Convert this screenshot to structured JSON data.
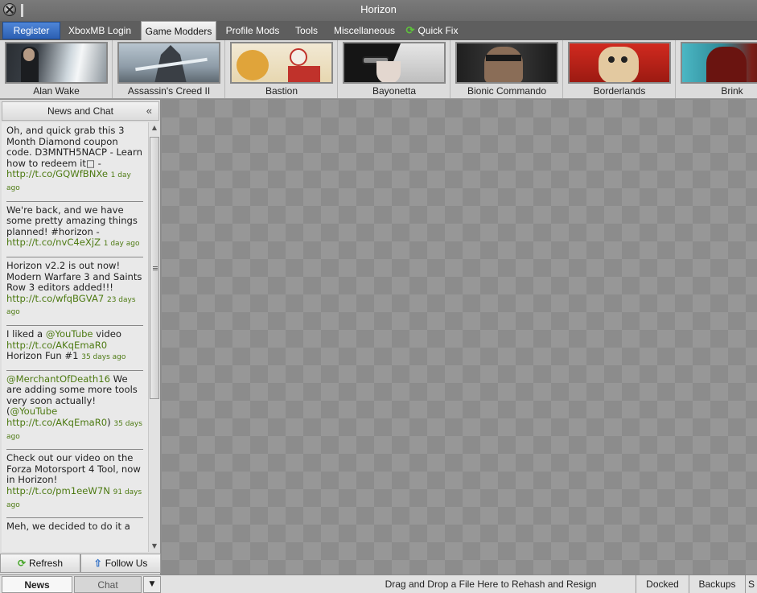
{
  "window": {
    "title": "Horizon"
  },
  "menu": {
    "tabs": [
      {
        "label": "Register"
      },
      {
        "label": "XboxMB Login"
      },
      {
        "label": "Game Modders"
      },
      {
        "label": "Profile Mods"
      },
      {
        "label": "Tools"
      },
      {
        "label": "Miscellaneous"
      },
      {
        "label": "Quick Fix"
      }
    ],
    "active_tab": "Game Modders"
  },
  "games": [
    {
      "name": "Alan Wake"
    },
    {
      "name": "Assassin's Creed II"
    },
    {
      "name": "Bastion"
    },
    {
      "name": "Bayonetta"
    },
    {
      "name": "Bionic Commando"
    },
    {
      "name": "Borderlands"
    },
    {
      "name": "Brink"
    }
  ],
  "news_panel": {
    "header": "News and Chat",
    "collapse_glyph": "«",
    "items": [
      {
        "text": "Oh, and quick grab this 3 Month Diamond coupon code. D3MNTH5NACP - Learn how to redeem it□ - ",
        "link": "http://t.co/GQWfBNXe",
        "time": "1 day ago"
      },
      {
        "text": "We're back, and we have some pretty amazing things planned! #horizon - ",
        "link": "http://t.co/nvC4eXjZ",
        "time": "1 day ago"
      },
      {
        "text": "Horizon v2.2 is out now! Modern Warfare 3 and Saints Row 3 editors added!!! ",
        "link": "http://t.co/wfqBGVA7",
        "time": "23 days ago"
      },
      {
        "pre": "I liked a ",
        "mention": "@YouTube",
        "text": " video ",
        "link": "http://t.co/AKqEmaR0",
        "post": " Horizon Fun #1",
        "time": "35 days ago"
      },
      {
        "mention": "@MerchantOfDeath16",
        "text": " We are adding some more tools very soon actually! (",
        "mention2": "@YouTube",
        "link": "http://t.co/AKqEmaR0",
        "post": ")",
        "time": "35 days ago"
      },
      {
        "text": "Check out our video on the Forza Motorsport 4 Tool, now in Horizon! ",
        "link": "http://t.co/pm1eeW7N",
        "time": "91 days ago"
      },
      {
        "text": "Meh, we decided to do it a",
        "link": "",
        "time": ""
      }
    ],
    "buttons": {
      "refresh": "Refresh",
      "follow": "Follow Us"
    }
  },
  "statusbar": {
    "tabs": {
      "news": "News",
      "chat": "Chat"
    },
    "message": "Drag and Drop a File Here to Rehash and Resign",
    "buttons": {
      "docked": "Docked",
      "backups": "Backups",
      "more": "S"
    }
  }
}
